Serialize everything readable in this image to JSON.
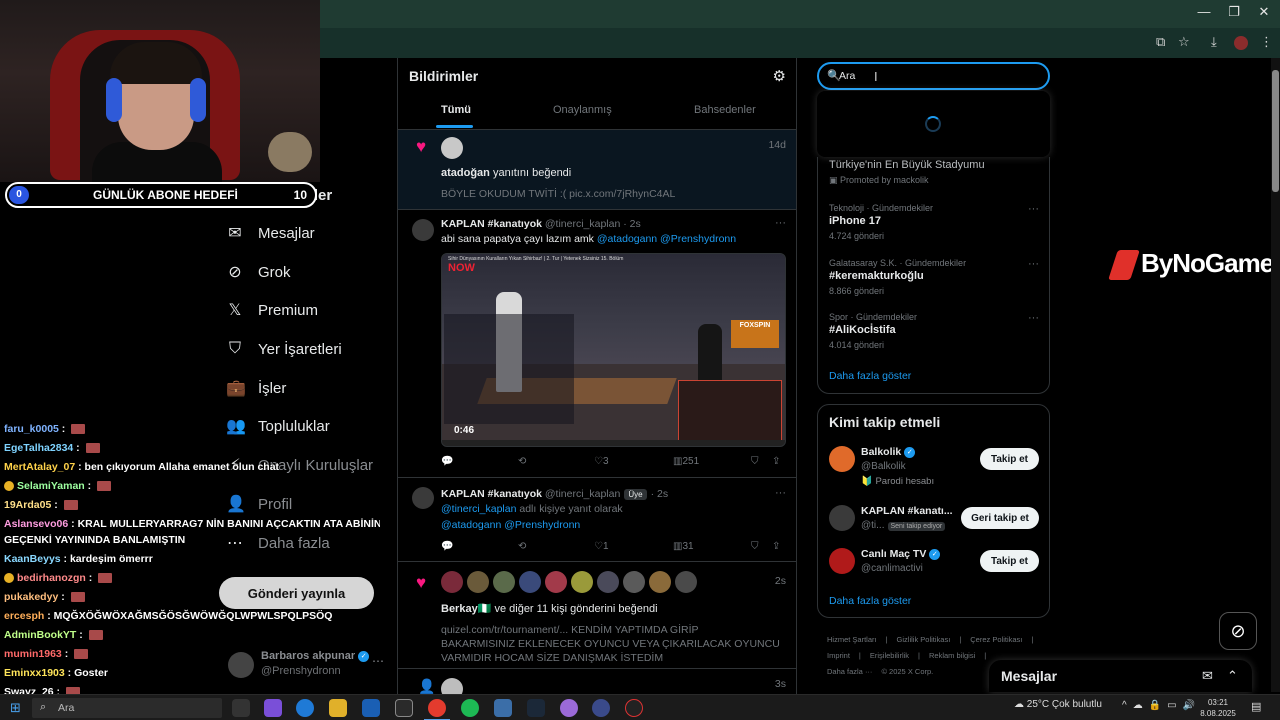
{
  "browser": {
    "window_controls": [
      "—",
      "❐",
      "✕"
    ],
    "toolbar_icons": [
      "⧉",
      "☆",
      "⤓",
      "⋮"
    ]
  },
  "stream": {
    "goal_start": "0",
    "goal_title": "GÜNLÜK ABONE HEDEFİ",
    "goal_end": "10"
  },
  "nav": {
    "items": [
      {
        "label": "Bildirimler",
        "icon": "bell-icon",
        "glyph": "🔔"
      },
      {
        "label": "Mesajlar",
        "icon": "mail-icon",
        "glyph": "✉"
      },
      {
        "label": "Grok",
        "icon": "grok-icon",
        "glyph": "⊘"
      },
      {
        "label": "Premium",
        "icon": "x-logo-icon",
        "glyph": "𝕏"
      },
      {
        "label": "Yer İşaretleri",
        "icon": "bookmark-icon",
        "glyph": "⛉"
      },
      {
        "label": "İşler",
        "icon": "briefcase-icon",
        "glyph": "💼"
      },
      {
        "label": "Topluluklar",
        "icon": "people-icon",
        "glyph": "👥"
      },
      {
        "label": "Onaylı Kuruluşlar",
        "icon": "lightning-icon",
        "glyph": "⚡"
      },
      {
        "label": "Profil",
        "icon": "person-icon",
        "glyph": "👤"
      },
      {
        "label": "Daha fazla",
        "icon": "more-circle-icon",
        "glyph": "⋯"
      }
    ],
    "post_button": "Gönderi yayınla",
    "profile_name": "Barbaros akpunar",
    "profile_handle": "@Prenshydronn",
    "profile_more": "⋯"
  },
  "chat": [
    {
      "user": "faru_k0005",
      "msg": "",
      "color": "#7fb3ff",
      "emote": true
    },
    {
      "user": "EgeTalha2834",
      "msg": "",
      "color": "#7fd3ff",
      "emote": true
    },
    {
      "user": "MertAtalay_07",
      "msg": "ben çıkıyorum Allaha emanet olun chat",
      "color": "#ffd24a"
    },
    {
      "user": "SelamiYaman",
      "msg": "",
      "color": "#9effa0",
      "emote": true,
      "badge": "✚"
    },
    {
      "user": "19Arda05",
      "msg": "",
      "color": "#ffe08a",
      "emote": true
    },
    {
      "user": "Aslansevo06",
      "msg": "KRAL MULLERYARRAG7 NİN BANINI AÇCAKTIN ATA ABİNİN",
      "color": "#ff9de0"
    },
    {
      "user": "",
      "msg": "GEÇENKİ YAYININDA BANLAMIŞTIN",
      "color": "#ffffff"
    },
    {
      "user": "KaanBeyys",
      "msg": "kardeşim ömerrr",
      "color": "#8ad8ff"
    },
    {
      "user": "bedirhanozgn",
      "msg": "",
      "color": "#ff8a8a",
      "emote": true,
      "badge": "!"
    },
    {
      "user": "pukakedyy",
      "msg": "",
      "color": "#ffbf7f",
      "emote": true
    },
    {
      "user": "ercesph",
      "msg": "MQĞXÖĞWÖXAĞMSĞÖSĞWÖWĞQLWPWLSPQLPSÖQ",
      "color": "#ffaf5a"
    },
    {
      "user": "AdminBookYT",
      "msg": "",
      "color": "#c0ff8a",
      "emote": true
    },
    {
      "user": "mumin1963",
      "msg": "",
      "color": "#ff6a6a",
      "emote": true
    },
    {
      "user": "Eminxx1903",
      "msg": "Goster",
      "color": "#ffe55a"
    },
    {
      "user": "Swayz_26",
      "msg": "",
      "color": "#ffffff",
      "emote": true
    }
  ],
  "center": {
    "title": "Bildirimler",
    "tabs": [
      "Tümü",
      "Onaylanmış",
      "Bahsedenler"
    ],
    "notif1": {
      "actor": "atadoğan",
      "action": " yanıtını beğendi",
      "quote": "BÖYLE OKUDUM TWİTİ :( pic.x.com/7jRhynC4AL",
      "time": "14d"
    },
    "post1": {
      "name": "KAPLAN #kanatıyok",
      "handle": "@tinerci_kaplan · 2s",
      "text": "abi sana papatya çayı lazım amk ",
      "mentions": "@atadogann @Prenshydronn",
      "media_logo": "NOW",
      "media_caption": "Sihir Dünyasının Kuralların Yıkan Sihirbaz! | 2. Tur | Yetenek Sizsiniz 15. Bölüm",
      "media_brand": "FOXSPIN",
      "media_time": "0:46",
      "replies": "",
      "reposts": "",
      "likes": "3",
      "views": "251"
    },
    "post2": {
      "name": "KAPLAN #kanatıyok",
      "handle": "@tinerci_kaplan",
      "badge": "Üye",
      "time": "· 2s",
      "line1_mention": "@tinerci_kaplan",
      "line1_rest": " adlı kişiye yanıt olarak",
      "line2": "@atadogann @Prenshydronn",
      "likes": "1",
      "views": "31"
    },
    "notif2": {
      "actor": "Berkay",
      "flag": "🇳🇬",
      "action": " ve diğer 11 kişi gönderini beğendi",
      "line1": "quizel.com/tr/tournament/... KENDİM YAPTIMDA GİRİP",
      "line2": "BAKARMISINIZ EKLENECEK OYUNCU VEYA ÇIKARILACAK OYUNCU",
      "line3": "VARMIDIR HOCAM SİZE DANIŞMAK İSTEDİM",
      "time": "2s"
    },
    "notif3_time": "3s"
  },
  "search": {
    "value": "Ara",
    "placeholder": "Ara"
  },
  "trends": {
    "promoted_title": "Türkiye'nin En Büyük Stadyumu",
    "promoted_by": "Promoted by mackolik",
    "items": [
      {
        "category": "Teknoloji · Gündemdekiler",
        "name": "iPhone 17",
        "count": "4.724 gönderi"
      },
      {
        "category": "Galatasaray S.K. · Gündemdekiler",
        "name": "#keremakturkoğlu",
        "count": "8.866 gönderi"
      },
      {
        "category": "Spor · Gündemdekiler",
        "name": "#AliKocİstifa",
        "count": "4.014 gönderi"
      }
    ],
    "show_more": "Daha fazla göster"
  },
  "who_to_follow": {
    "title": "Kimi takip etmeli",
    "users": [
      {
        "name": "Balkolik",
        "handle": "@Balkolik",
        "extra": "🔰 Parodi hesabı",
        "button": "Takip et",
        "verified": true
      },
      {
        "name": "KAPLAN #kanatı...",
        "handle": "@ti...",
        "extra_badge": "Seni takip ediyor",
        "button": "Geri takip et",
        "verified": false
      },
      {
        "name": "Canlı Maç TV",
        "handle": "@canlimactivi",
        "button": "Takip et",
        "verified": true
      }
    ],
    "show_more": "Daha fazla göster"
  },
  "footer": [
    "Hizmet Şartları",
    "Gizlilik Politikası",
    "Çerez Politikası",
    "Imprint",
    "Erişilebilirlik",
    "Reklam bilgisi",
    "Daha fazla ···",
    "© 2025 X Corp."
  ],
  "messages": {
    "title": "Mesajlar"
  },
  "brand_overlay": "ByNoGame",
  "taskbar": {
    "search": "Ara",
    "weather": "25°C  Çok bulutlu",
    "time": "03:21",
    "date": "8.08.2025"
  },
  "colors": {
    "accent": "#1d9bf0",
    "like": "#f91880"
  }
}
